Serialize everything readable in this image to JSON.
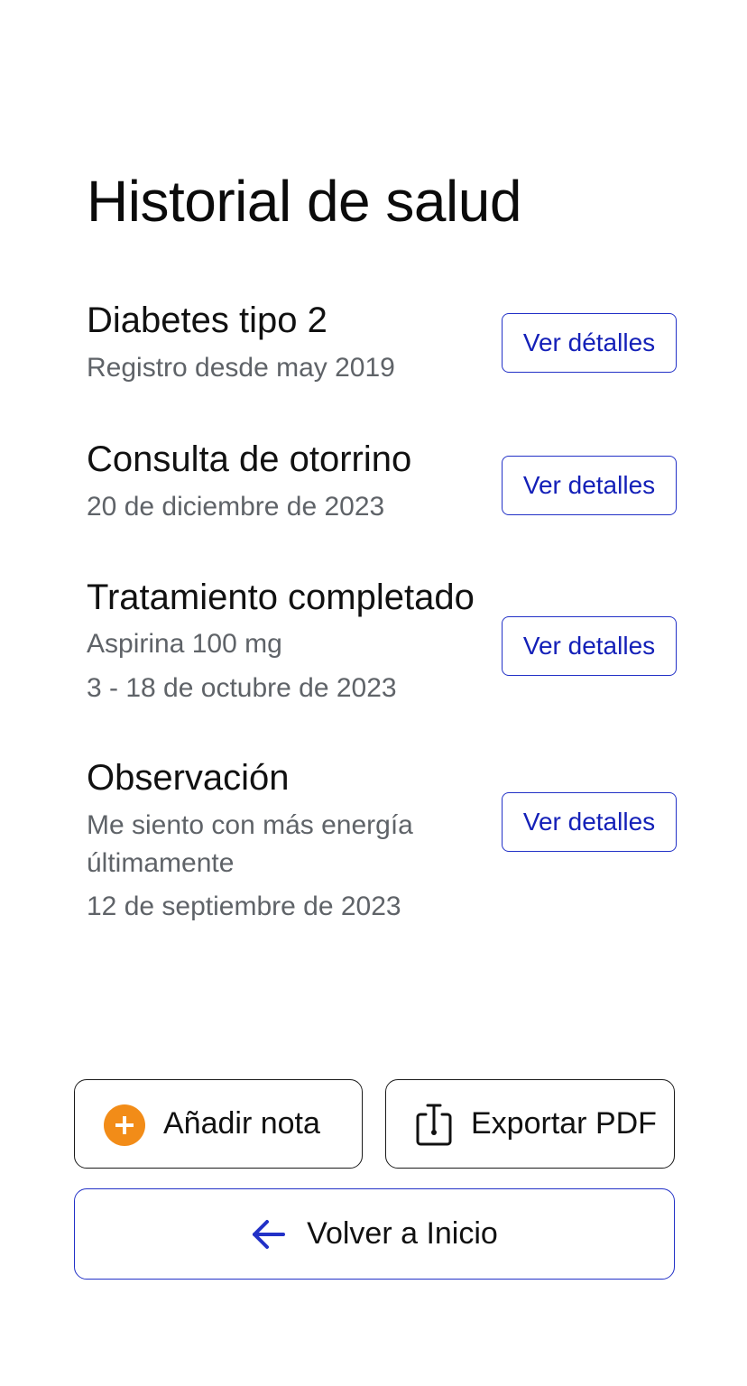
{
  "header": {
    "title": "Historial de salud"
  },
  "entries": [
    {
      "title": "Diabetes tipo 2",
      "lines": [
        "Registro desde may 2019"
      ],
      "button_label": "Ver détalles"
    },
    {
      "title": "Consulta de otorrino",
      "lines": [
        "20 de diciembre de 2023"
      ],
      "button_label": "Ver detalles"
    },
    {
      "title": "Tratamiento completado",
      "lines": [
        "Aspirina 100 mg",
        "3 - 18 de octubre de 2023"
      ],
      "button_label": "Ver detalles"
    },
    {
      "title": "Observación",
      "lines": [
        "Me siento con más energía últimamente",
        "12 de septiembre de 2023"
      ],
      "button_label": "Ver detalles"
    }
  ],
  "actions": {
    "add_note_label": "Añadir nota",
    "add_note_icon": "plus-circle-icon",
    "export_label": "Exportar PDF",
    "export_icon": "share-export-icon",
    "home_label": "Volver a Inicio",
    "home_icon": "arrow-left-icon"
  },
  "colors": {
    "accent": "#1420b8",
    "add_icon": "#f28c18",
    "secondary_text": "#5f6368"
  }
}
